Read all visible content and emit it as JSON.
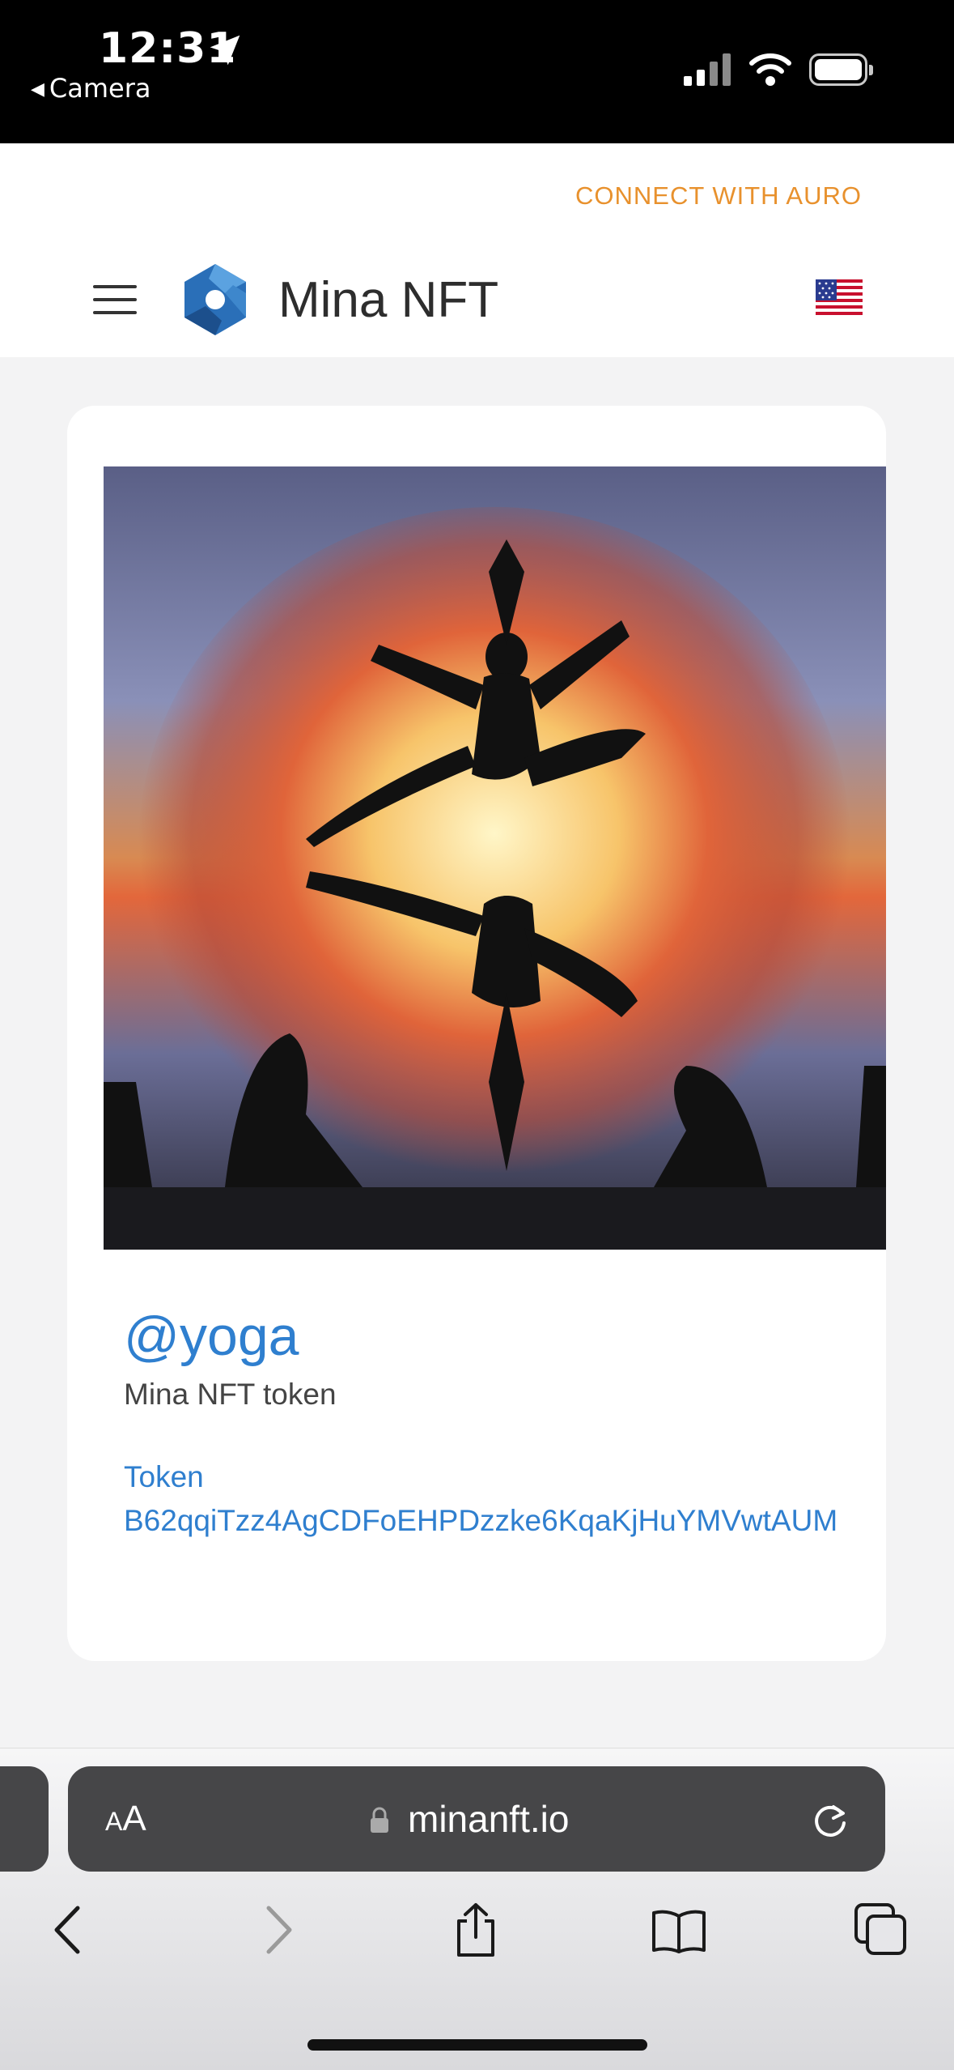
{
  "status_bar": {
    "time": "12:31",
    "back_app": "Camera",
    "icons": [
      "location-arrow-icon",
      "signal-icon",
      "wifi-icon",
      "battery-icon"
    ]
  },
  "header": {
    "connect_label": "CONNECT WITH AURO",
    "brand": "Mina NFT",
    "icons": [
      "menu-icon",
      "mina-logo",
      "us-flag-icon"
    ],
    "accent_color": "#e8912d"
  },
  "nft": {
    "name": "@yoga",
    "description": "Mina NFT token",
    "token_label": "Token",
    "token_value": "B62qqiTzz4AgCDFoEHPDzzke6KqaKjHuYMVwtAUM",
    "link_color": "#2f7fcf"
  },
  "browser": {
    "text_size_label_small": "A",
    "text_size_label_large": "A",
    "url": "minanft.io",
    "toolbar": [
      "back-icon",
      "forward-icon",
      "share-icon",
      "bookmarks-icon",
      "tabs-icon"
    ]
  }
}
